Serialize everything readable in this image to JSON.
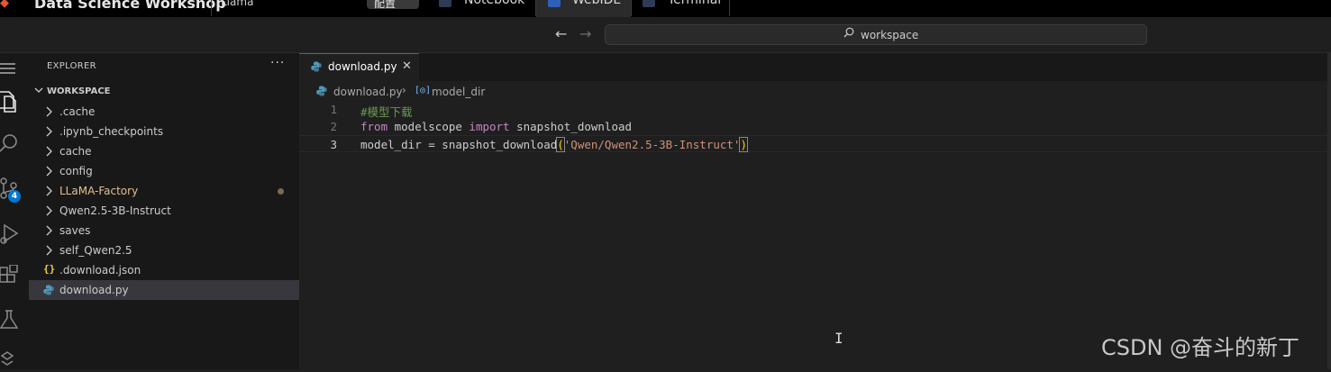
{
  "appbar": {
    "title": "Data Science Workshop",
    "user": "Llama",
    "config_button": "配置",
    "tabs": [
      {
        "label": "Notebook",
        "icon": "notebook-icon"
      },
      {
        "label": "WebIDE",
        "icon": "webide-icon",
        "active": true
      },
      {
        "label": "Terminal",
        "icon": "terminal-icon"
      }
    ]
  },
  "commandbar": {
    "search_text": "workspace"
  },
  "activitybar": {
    "items": [
      "menu-icon",
      "files-icon",
      "search-icon",
      "source-control-icon",
      "run-debug-icon",
      "extensions-icon",
      "testing-icon",
      "remote-icon"
    ],
    "source_control_badge": "4"
  },
  "sidebar": {
    "title": "EXPLORER",
    "more": "···",
    "workspace_label": "WORKSPACE",
    "items": [
      {
        "label": ".cache",
        "type": "folder"
      },
      {
        "label": ".ipynb_checkpoints",
        "type": "folder"
      },
      {
        "label": "cache",
        "type": "folder"
      },
      {
        "label": "config",
        "type": "folder"
      },
      {
        "label": "LLaMA-Factory",
        "type": "folder",
        "modified": true
      },
      {
        "label": "Qwen2.5-3B-Instruct",
        "type": "folder"
      },
      {
        "label": "saves",
        "type": "folder"
      },
      {
        "label": "self_Qwen2.5",
        "type": "folder"
      },
      {
        "label": ".download.json",
        "type": "json"
      },
      {
        "label": "download.py",
        "type": "python",
        "selected": true
      }
    ]
  },
  "editor": {
    "tab_label": "download.py",
    "breadcrumb_file": "download.py",
    "breadcrumb_symbol": "model_dir",
    "lines": [
      {
        "number": "1",
        "comment": "#模型下载"
      },
      {
        "number": "2",
        "kw1": "from",
        "mod": " modelscope ",
        "kw2": "import",
        "rest": " snapshot_download"
      },
      {
        "number": "3",
        "pre": "model_dir = snapshot_download",
        "open": "(",
        "str": "'Qwen/Qwen2.5-3B-Instruct'",
        "close": ")"
      }
    ]
  },
  "watermark": "CSDN @奋斗的新丁",
  "colors": {
    "accent": "#0078d4",
    "comment": "#6a9955",
    "keyword": "#c586c0",
    "string": "#ce9178",
    "modified": "#e2c08d"
  }
}
